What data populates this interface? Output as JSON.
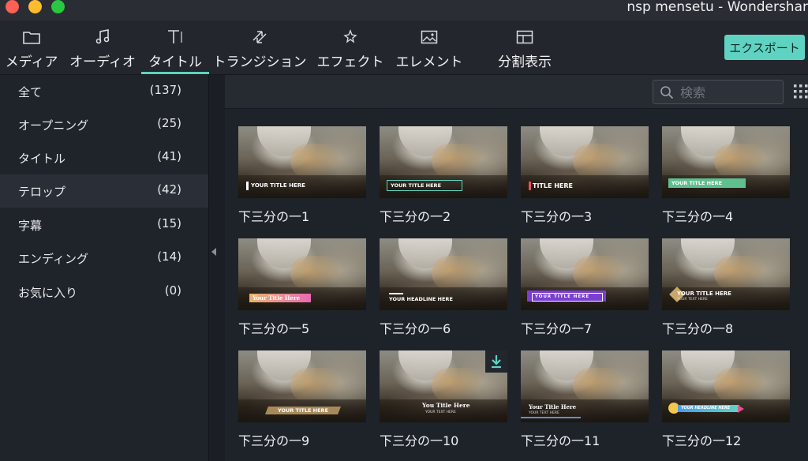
{
  "window": {
    "title": "nsp mensetu - Wondershar"
  },
  "toolbar": {
    "tabs": [
      {
        "label": "メディア",
        "icon": "folder-icon"
      },
      {
        "label": "オーディオ",
        "icon": "music-note-icon"
      },
      {
        "label": "タイトル",
        "icon": "text-title-icon"
      },
      {
        "label": "トランジション",
        "icon": "transition-icon"
      },
      {
        "label": "エフェクト",
        "icon": "effect-sparkle-icon"
      },
      {
        "label": "エレメント",
        "icon": "image-element-icon"
      },
      {
        "label": "分割表示",
        "icon": "split-screen-icon"
      }
    ],
    "active_tab": "タイトル",
    "export_label": "エクスポート"
  },
  "sidebar": {
    "items": [
      {
        "name": "全て",
        "count": "(137)"
      },
      {
        "name": "オープニング",
        "count": "(25)"
      },
      {
        "name": "タイトル",
        "count": "(41)"
      },
      {
        "name": "テロップ",
        "count": "(42)"
      },
      {
        "name": "字幕",
        "count": "(15)"
      },
      {
        "name": "エンディング",
        "count": "(14)"
      },
      {
        "name": "お気に入り",
        "count": "(0)"
      }
    ],
    "selected": "テロップ"
  },
  "search": {
    "placeholder": "検索"
  },
  "colors": {
    "accent": "#5fd3c2",
    "background": "#1e2229",
    "sidebar": "#1f232a"
  },
  "thumbnails": [
    {
      "label": "下三分の一1",
      "overlay": [
        "YOUR TITLE HERE"
      ]
    },
    {
      "label": "下三分の一2",
      "overlay": [
        "YOUR TITLE HERE"
      ]
    },
    {
      "label": "下三分の一3",
      "overlay": [
        "TITLE HERE"
      ]
    },
    {
      "label": "下三分の一4",
      "overlay": [
        "YOUR TITLE HERE"
      ]
    },
    {
      "label": "下三分の一5",
      "overlay": [
        "Your Title Here"
      ]
    },
    {
      "label": "下三分の一6",
      "overlay": [
        "YOUR HEADLINE HERE"
      ]
    },
    {
      "label": "下三分の一7",
      "overlay": [
        "YOUR TITLE HERE"
      ]
    },
    {
      "label": "下三分の一8",
      "overlay": [
        "YOUR TITLE HERE",
        "YOUR TEXT HERE"
      ]
    },
    {
      "label": "下三分の一9",
      "overlay": [
        "YOUR TITLE HERE"
      ]
    },
    {
      "label": "下三分の一10",
      "overlay": [
        "You Title Here",
        "YOUR TEXT HERE"
      ],
      "download": true
    },
    {
      "label": "下三分の一11",
      "overlay": [
        "Your Title Here",
        "YOUR TEXT HERE"
      ]
    },
    {
      "label": "下三分の一12",
      "overlay": [
        "YOUR HEADLINE HERE"
      ]
    }
  ]
}
